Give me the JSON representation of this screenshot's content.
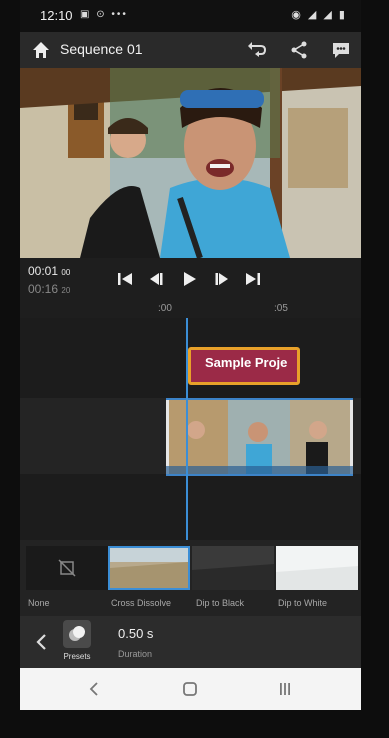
{
  "status_bar": {
    "time": "12:10",
    "left_icons": "▣ ⊙ •••",
    "right_icons": "◉ ◢ ◢ ▮"
  },
  "header": {
    "title": "Sequence 01"
  },
  "player": {
    "current_time": "00:01",
    "current_frames": "00",
    "total_time": "00:16",
    "total_frames": "20"
  },
  "ruler": {
    "ticks": [
      ":00",
      ":05"
    ]
  },
  "timeline": {
    "title_clip_label": "Sample Proje"
  },
  "transitions": {
    "items": [
      {
        "label": "None"
      },
      {
        "label": "Cross Dissolve"
      },
      {
        "label": "Dip to Black"
      },
      {
        "label": "Dip to White"
      }
    ],
    "selected": "Cross Dissolve"
  },
  "bottom_bar": {
    "presets_label": "Presets",
    "duration_value": "0.50 s",
    "duration_label": "Duration"
  },
  "colors": {
    "accent": "#3b8ed6",
    "title_clip": "#9b2a47",
    "clip_border": "#e8a12a"
  }
}
